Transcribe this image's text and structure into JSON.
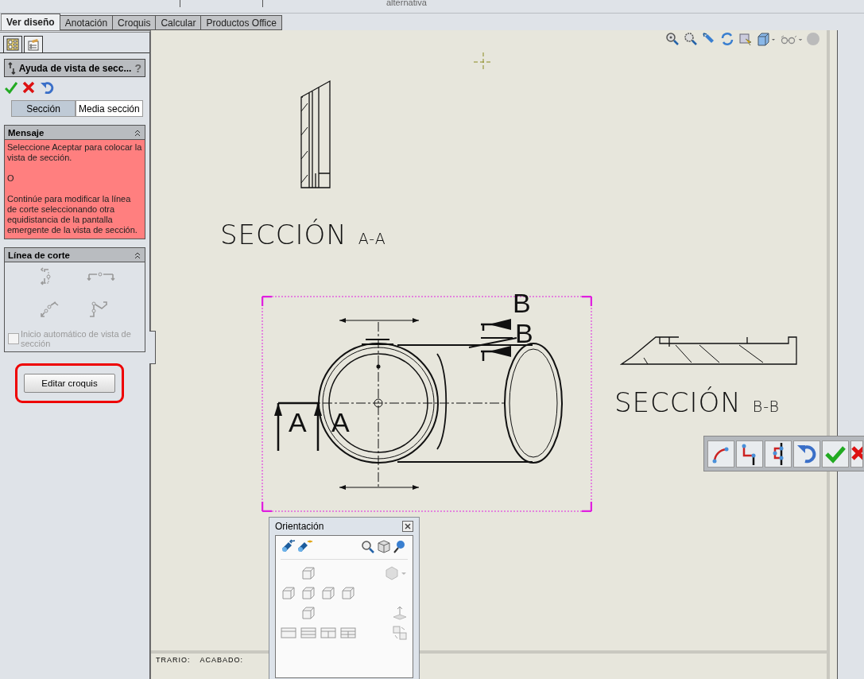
{
  "top_bar": {
    "caption": "alternativa"
  },
  "tabs": [
    {
      "label": "Ver diseño",
      "selected": true
    },
    {
      "label": "Anotación",
      "selected": false
    },
    {
      "label": "Croquis",
      "selected": false
    },
    {
      "label": "Calcular",
      "selected": false
    },
    {
      "label": "Productos Office",
      "selected": false
    }
  ],
  "property_manager": {
    "title": "Ayuda de vista de secc...",
    "help": "?",
    "modes": [
      {
        "label": "Sección",
        "selected": true
      },
      {
        "label": "Media sección",
        "selected": false
      }
    ],
    "message": {
      "title": "Mensaje",
      "expanded": true,
      "paragraphs": [
        "Seleccione Aceptar para colocar la vista de sección.",
        "O",
        "Continúe para modificar la línea de corte seleccionando otra equidistancia de la pantalla emergente de la vista de sección."
      ]
    },
    "cut_line": {
      "title": "Línea de corte",
      "expanded": true,
      "auto_start": {
        "label": "Inicio automático de vista de sección",
        "checked": false,
        "disabled": true
      }
    },
    "edit_sketch_button": {
      "label": "Editar croquis",
      "highlighted": true
    }
  },
  "drawing": {
    "views": [
      {
        "title": "SECCIÓN",
        "suffix": "A-A"
      },
      {
        "title": "SECCIÓN",
        "suffix": "B-B"
      }
    ],
    "section_letters": [
      {
        "kind": "b",
        "text": "B"
      },
      {
        "kind": "b",
        "text": "B"
      },
      {
        "kind": "a",
        "text": "A"
      },
      {
        "kind": "a",
        "text": "A"
      }
    ],
    "title_block": [
      "TRARIO:",
      "ACABADO:"
    ]
  },
  "orientation": {
    "title": "Orientación"
  }
}
